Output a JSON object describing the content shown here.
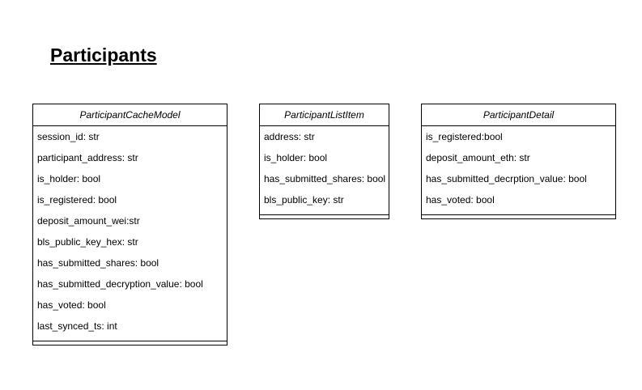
{
  "title": "Participants",
  "classes": [
    {
      "name": "ParticipantCacheModel",
      "attributes": [
        "session_id: str",
        "participant_address: str",
        "is_holder: bool",
        "is_registered: bool",
        "deposit_amount_wei:str",
        "bls_public_key_hex: str",
        "has_submitted_shares: bool",
        "has_submitted_decryption_value: bool",
        "has_voted: bool",
        "last_synced_ts: int"
      ]
    },
    {
      "name": "ParticipantListItem",
      "attributes": [
        "address: str",
        "is_holder: bool",
        "has_submitted_shares: bool",
        "bls_public_key: str"
      ]
    },
    {
      "name": "ParticipantDetail",
      "attributes": [
        "is_registered:bool",
        "deposit_amount_eth: str",
        "has_submitted_decrption_value: bool",
        "has_voted: bool"
      ]
    }
  ]
}
